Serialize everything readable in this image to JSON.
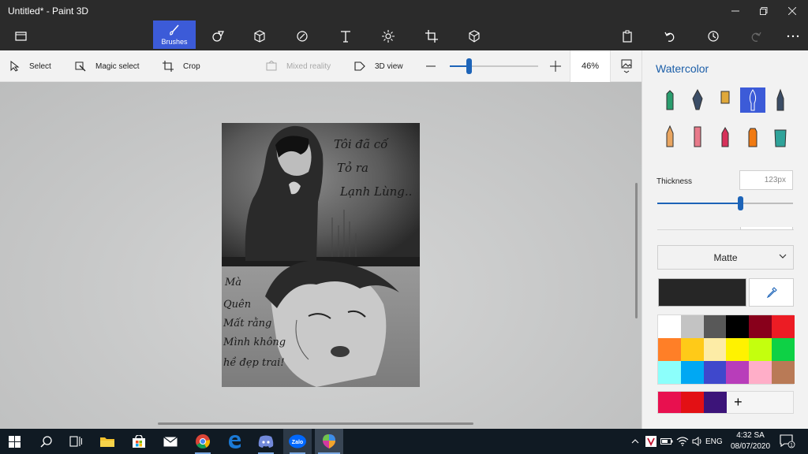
{
  "window": {
    "title": "Untitled* - Paint 3D"
  },
  "toolbar": {
    "brushes_label": "Brushes",
    "left_tools": [
      "menu-folder-icon"
    ],
    "tools": [
      "2d-shapes-icon",
      "3d-shapes-icon",
      "stickers-icon",
      "text-icon",
      "effects-icon",
      "canvas-icon",
      "3d-library-icon"
    ],
    "right_tools": [
      "paste-icon",
      "undo-icon",
      "history-icon",
      "redo-icon",
      "more-icon"
    ]
  },
  "subtoolbar": {
    "select_label": "Select",
    "magic_select_label": "Magic select",
    "crop_label": "Crop",
    "mixed_reality_label": "Mixed reality",
    "view3d_label": "3D view",
    "zoom_percent": "46%",
    "zoom_level": 0.21
  },
  "artwork": {
    "top_text": [
      "Tôi đã cố",
      "Tỏ ra",
      "Lạnh Lùng.."
    ],
    "bottom_text": [
      "Mà",
      "Quên",
      "Mất rằng",
      "Mình không",
      "hề đẹp trai!"
    ]
  },
  "panel": {
    "title": "Watercolor",
    "brushes": [
      {
        "name": "marker-brush-icon",
        "color": "#2a9d6e"
      },
      {
        "name": "calligraphy-pen-brush-icon",
        "color": "#3b4d66"
      },
      {
        "name": "oil-brush-icon",
        "color": "#e0a83a"
      },
      {
        "name": "watercolor-brush-icon",
        "color": "#ffffff"
      },
      {
        "name": "pixel-pen-brush-icon",
        "color": "#3b4d66"
      },
      {
        "name": "pencil-brush-icon",
        "color": "#e9a560"
      },
      {
        "name": "eraser-brush-icon",
        "color": "#e87a8a"
      },
      {
        "name": "crayon-brush-icon",
        "color": "#d6315a"
      },
      {
        "name": "spray-can-brush-icon",
        "color": "#f07a12"
      },
      {
        "name": "fill-bucket-brush-icon",
        "color": "#2fa39a"
      }
    ],
    "selected_brush_index": 3,
    "thickness_label": "Thickness",
    "thickness_value": "123px",
    "thickness_level": 0.61,
    "finish_value": "Matte",
    "current_color": "#262626",
    "palette": [
      "#ffffff",
      "#c3c3c3",
      "#585858",
      "#000000",
      "#88001b",
      "#ec1c24",
      "#ff7f27",
      "#ffca18",
      "#fdeca6",
      "#fff200",
      "#c4ff0e",
      "#0ed145",
      "#8cfffb",
      "#00a8f3",
      "#3f48cc",
      "#b83dba",
      "#ffaec8",
      "#b97a56"
    ],
    "custom_colors": [
      "#e8104f",
      "#e31014",
      "#3c1479"
    ],
    "add_color_label": "+"
  },
  "taskbar": {
    "apps": [
      "windows-start-icon",
      "search-icon",
      "task-view-icon",
      "file-explorer-icon",
      "store-icon",
      "mail-icon",
      "chrome-icon",
      "edge-icon",
      "discord-icon",
      "zalo-icon",
      "paint-3d-icon"
    ],
    "zalo_label": "Zalo",
    "language": "ENG",
    "time": "4:32 SA",
    "date": "08/07/2020",
    "notification_count": "1"
  }
}
